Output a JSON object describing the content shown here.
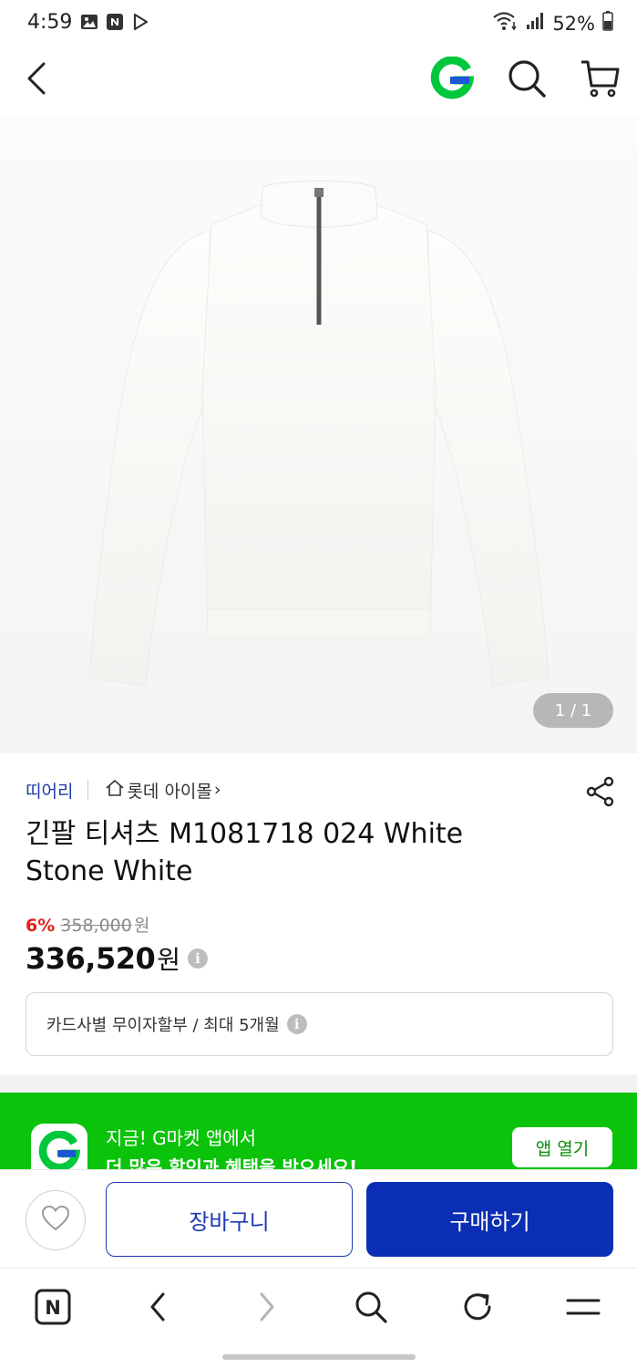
{
  "status_bar": {
    "time": "4:59",
    "battery": "52%",
    "icons": [
      "gallery-icon",
      "naver-app-icon",
      "play-icon",
      "wifi-icon",
      "signal-icon",
      "battery-icon"
    ]
  },
  "app_bar": {
    "icons": [
      "back-icon",
      "gmarket-logo-icon",
      "search-icon",
      "cart-icon"
    ],
    "logo_letter": "G",
    "brand_color": "#00c73c"
  },
  "product": {
    "image_pager": "1 / 1",
    "seller": "띠어리",
    "shop": "롯데 아이몰",
    "shop_chevron": "›",
    "title_line1": "긴팔 티셔츠 M1081718 024 White",
    "title_line2": "Stone White",
    "discount_rate": "6%",
    "original_price": "358,000",
    "original_won": "원",
    "final_price": "336,520",
    "final_won": "원",
    "info_glyph": "i",
    "installment": "카드사별 무이자할부 / 최대 5개월"
  },
  "app_banner": {
    "line1": "지금! G마켓 앱에서",
    "line2": "더 많은 할인과 혜택을 받으세요!",
    "open_button": "앱 열기",
    "background": "#0ac30a"
  },
  "purchase_bar": {
    "cart_label": "장바구니",
    "buy_label": "구매하기",
    "accent": "#0a2fb4"
  },
  "browser_nav": {
    "icons": [
      "naver-home-icon",
      "browser-back-icon",
      "browser-forward-icon",
      "browser-search-icon",
      "refresh-icon",
      "menu-icon"
    ],
    "home_letter": "N"
  }
}
